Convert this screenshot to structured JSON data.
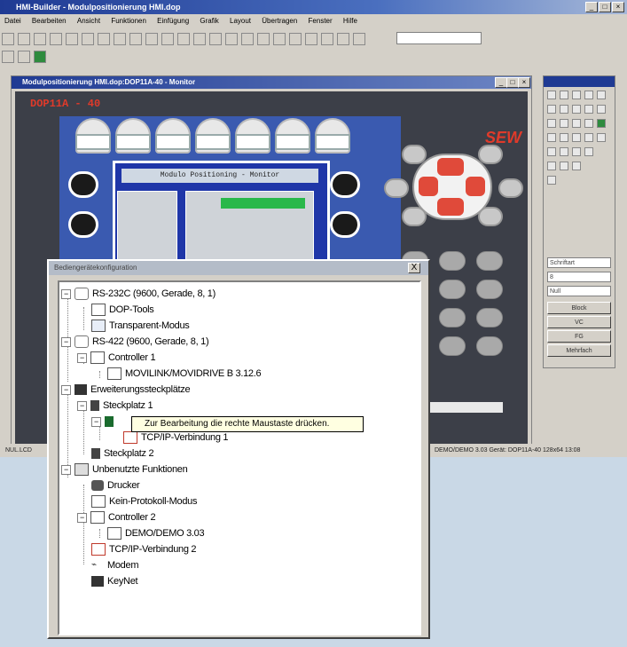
{
  "app": {
    "title": "HMI-Builder - Modulpositionierung HMI.dop",
    "menu": [
      "Datei",
      "Bearbeiten",
      "Ansicht",
      "Funktionen",
      "Einfügung",
      "Grafik",
      "Layout",
      "Übertragen",
      "Fenster",
      "Hilfe"
    ],
    "status_left": "NUL.LCD",
    "status_right": "DEMO/DEMO 3.03 Gerät: DOP11A-40 128x64 13:08"
  },
  "monitor": {
    "title": "Modulpositionierung HMI.dop:DOP11A-40 - Monitor",
    "device_label": "DOP11A - 40",
    "brand": "SEW",
    "screen_title": "Modulo Positioning - Monitor"
  },
  "palette": {
    "selects": [
      "Schriftart",
      "8",
      "Null"
    ],
    "buttons": [
      "Block",
      "VC",
      "FG",
      "Mehrfach"
    ]
  },
  "dialog": {
    "title": "Bediengerätekonfiguration",
    "close_label": "X",
    "tree": [
      {
        "label": "RS-232C (9600, Gerade, 8, 1)",
        "color": "#000000"
      },
      {
        "label": "DOP-Tools",
        "color": "#000000"
      },
      {
        "label": "Transparent-Modus",
        "color": "#000000"
      },
      {
        "label": "RS-422 (9600, Gerade, 8, 1)",
        "color": "#000000"
      },
      {
        "label": "Controller 1",
        "color": "#000000"
      },
      {
        "label": "MOVILINK/MOVIDRIVE B 3.12.6",
        "color": "#000000"
      },
      {
        "label": "Erweiterungssteckplätze",
        "color": "#000000"
      },
      {
        "label": "Steckplatz 1",
        "color": "#000000"
      },
      {
        "label": "TCP/IP-Verbindung 1",
        "color": "#000000"
      },
      {
        "label": "Steckplatz 2",
        "color": "#000000"
      },
      {
        "label": "Unbenutzte Funktionen",
        "color": "#000000"
      },
      {
        "label": "Drucker",
        "color": "#000000"
      },
      {
        "label": "Kein-Protokoll-Modus",
        "color": "#000000"
      },
      {
        "label": "Controller 2",
        "color": "#000000"
      },
      {
        "label": "DEMO/DEMO 3.03",
        "color": "#000000"
      },
      {
        "label": "TCP/IP-Verbindung 2",
        "color": "#000000"
      },
      {
        "label": "Modem",
        "color": "#000000"
      },
      {
        "label": "KeyNet",
        "color": "#000000"
      }
    ],
    "tooltip": "Zur Bearbeitung die rechte Maustaste drücken."
  }
}
